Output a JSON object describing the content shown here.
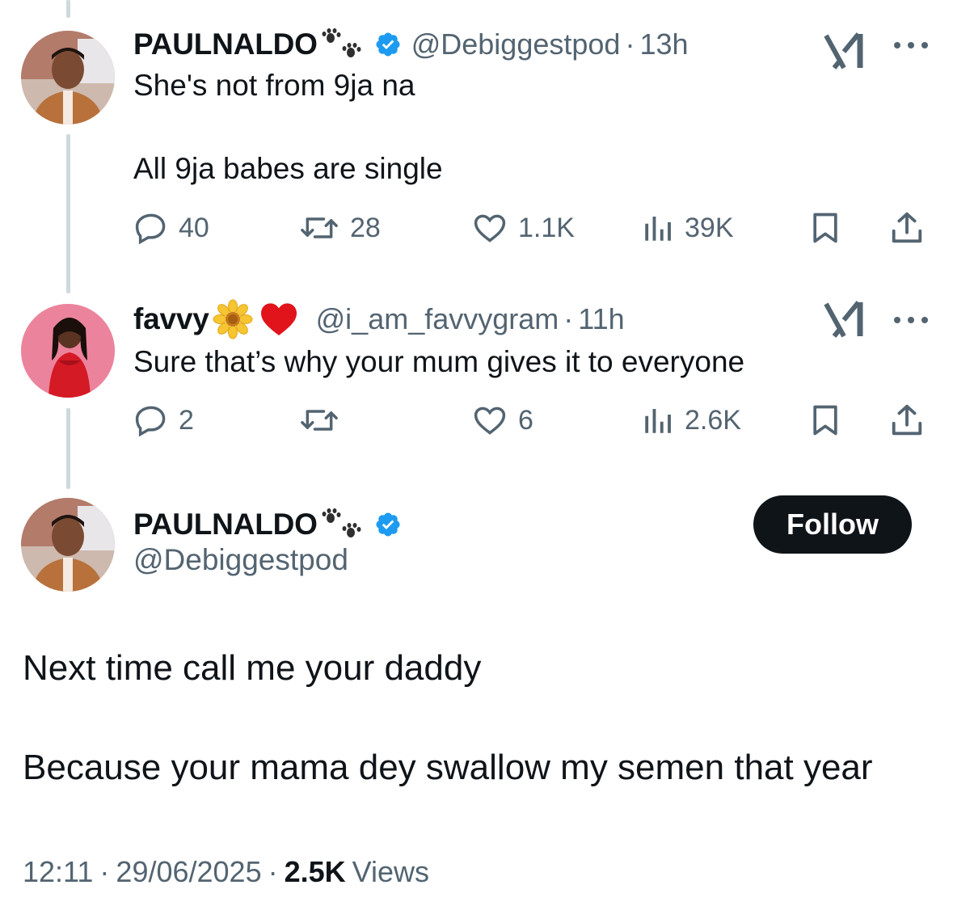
{
  "tweets": [
    {
      "name": "PAULNALDO",
      "handle": "@Debiggestpod",
      "time": "13h",
      "line1": "She's not from 9ja na",
      "line2": "All 9ja babes are single",
      "replies": "40",
      "reposts": "28",
      "likes": "1.1K",
      "views": "39K",
      "verified": true,
      "emojis": [
        "paw-prints"
      ]
    },
    {
      "name": "favvy",
      "handle": "@i_am_favvygram",
      "time": "11h",
      "line1": "Sure that’s why your mum gives it to everyone",
      "replies": "2",
      "reposts": "",
      "likes": "6",
      "views": "2.6K",
      "verified": false,
      "emojis": [
        "sunflower",
        "red-heart"
      ]
    }
  ],
  "main": {
    "name": "PAULNALDO",
    "handle": "@Debiggestpod",
    "follow_label": "Follow",
    "line1": "Next time call me your daddy",
    "line2": "Because your mama dey swallow my semen that year",
    "time": "12:11",
    "date": "29/06/2025",
    "views_count": "2.5K",
    "views_label": "Views"
  },
  "colors": {
    "text": "#0f1419",
    "secondary": "#536471",
    "verified": "#1d9bf0",
    "thread_line": "#cfd9de",
    "follow_bg": "#0f1419"
  },
  "icons": [
    "reply-icon",
    "repost-icon",
    "like-icon",
    "views-icon",
    "bookmark-icon",
    "share-icon",
    "grok-icon",
    "more-icon",
    "verified-badge-icon"
  ]
}
